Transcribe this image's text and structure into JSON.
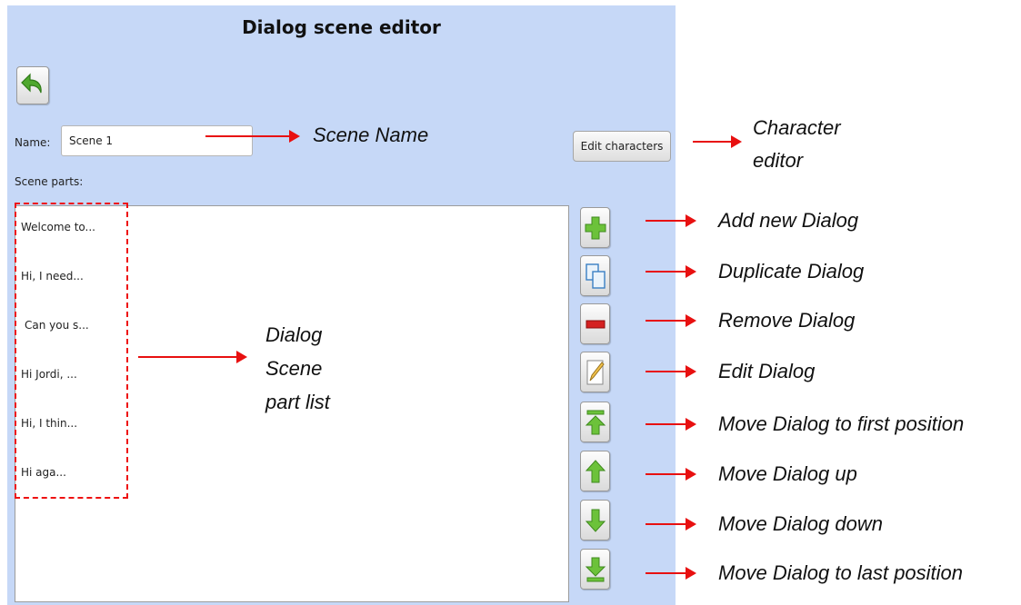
{
  "window": {
    "title": "Dialog scene editor"
  },
  "toolbar": {
    "back_icon": "back-arrow-icon"
  },
  "form": {
    "name_label": "Name:",
    "name_value": "Scene 1",
    "edit_characters_label": "Edit characters",
    "scene_parts_label": "Scene parts:"
  },
  "scene_parts": [
    "Welcome to...",
    "Hi, I need...",
    "Can you s...",
    "Hi Jordi, ...",
    "Hi, I thin...",
    "Hi aga..."
  ],
  "tools": [
    {
      "icon": "add-icon"
    },
    {
      "icon": "duplicate-icon"
    },
    {
      "icon": "remove-icon"
    },
    {
      "icon": "edit-icon"
    },
    {
      "icon": "move-first-icon"
    },
    {
      "icon": "move-up-icon"
    },
    {
      "icon": "move-down-icon"
    },
    {
      "icon": "move-last-icon"
    }
  ],
  "annotations": {
    "scene_name": "Scene Name",
    "character_editor_line1": "Character",
    "character_editor_line2": "editor",
    "dialog_list_line1": "Dialog",
    "dialog_list_line2": "Scene",
    "dialog_list_line3": "part list",
    "add": "Add new Dialog",
    "duplicate": "Duplicate Dialog",
    "remove": "Remove Dialog",
    "edit": "Edit Dialog",
    "move_first": "Move Dialog to first position",
    "move_up": "Move Dialog up",
    "move_down": "Move Dialog down",
    "move_last": "Move Dialog to last position"
  },
  "colors": {
    "panel_bg": "#c6d8f7",
    "annotation_red": "#e81010",
    "icon_green": "#6cc23a"
  }
}
